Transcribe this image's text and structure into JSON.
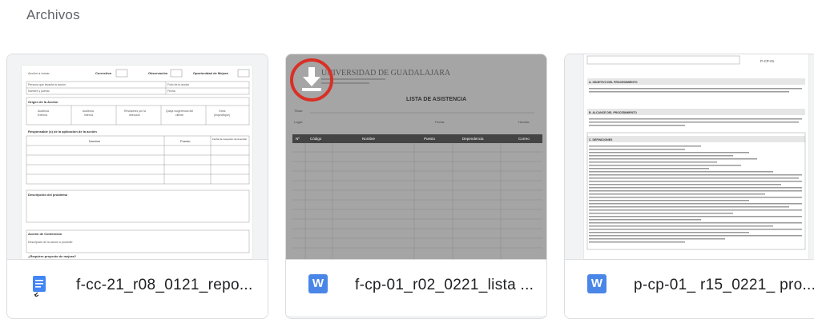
{
  "section": {
    "title": "Archivos"
  },
  "files": [
    {
      "name": "f-cc-21_r08_0121_repo...",
      "icon": "google-docs-icon"
    },
    {
      "name": "f-cp-01_r02_0221_lista ...",
      "icon": "word-icon"
    },
    {
      "name": "p-cp-01_ r15_0221_ pro...",
      "icon": "word-icon"
    }
  ],
  "preview2": {
    "header": "UNIVERSIDAD DE GUADALAJARA",
    "title": "LISTA DE ASISTENCIA",
    "columns": [
      "Nº",
      "Código",
      "Nombre",
      "Puesto",
      "Dependencia",
      "Correo"
    ]
  },
  "preview1": {
    "row_labels": [
      "Correctiva",
      "Observación",
      "Oportunidad de Mejora"
    ],
    "origin_label": "Origen de la Acción",
    "responsible_label": "Responsable (s) de la aplicación de la acción",
    "cols": [
      "Nombre",
      "Puesto",
      "Fecha de recepción de la acción"
    ],
    "problem_label": "Descripción del problema",
    "containment_label": "Acción de Contención",
    "project_label": "¿Requiere proyecto de mejora?"
  },
  "preview3": {
    "sections": [
      "A. OBJETIVO DEL PROCEDIMIENTO",
      "B. ALCANCE DEL PROCEDIMIENTO",
      "C. DEFINICIONES"
    ]
  },
  "colors": {
    "word": "#4a86e8",
    "docs": "#4285f4",
    "highlight": "#d93025"
  }
}
